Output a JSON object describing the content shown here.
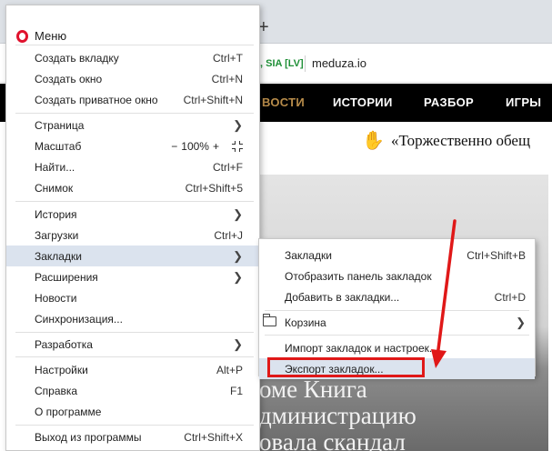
{
  "browser": {
    "new_tab_glyph": "+",
    "cert_label": ", SIA [LV]",
    "url": "meduza.io",
    "nav": [
      "ВОСТИ",
      "ИСТОРИИ",
      "РАЗБОР",
      "ИГРЫ"
    ],
    "headline": "«Торжественно обещ",
    "hero_lines": [
      "оме Книга",
      "дминистрацию",
      "овала скандал"
    ]
  },
  "menu": {
    "title": "Меню",
    "new_tab": {
      "label": "Создать вкладку",
      "shortcut": "Ctrl+T"
    },
    "new_window": {
      "label": "Создать окно",
      "shortcut": "Ctrl+N"
    },
    "new_private": {
      "label": "Создать приватное окно",
      "shortcut": "Ctrl+Shift+N"
    },
    "page": {
      "label": "Страница"
    },
    "zoom": {
      "label": "Масштаб",
      "minus": "−",
      "value": "100%",
      "plus": "+"
    },
    "find": {
      "label": "Найти...",
      "shortcut": "Ctrl+F"
    },
    "snapshot": {
      "label": "Снимок",
      "shortcut": "Ctrl+Shift+5"
    },
    "history": {
      "label": "История"
    },
    "downloads": {
      "label": "Загрузки",
      "shortcut": "Ctrl+J"
    },
    "bookmarks": {
      "label": "Закладки"
    },
    "extensions": {
      "label": "Расширения"
    },
    "news": {
      "label": "Новости"
    },
    "sync": {
      "label": "Синхронизация..."
    },
    "developer": {
      "label": "Разработка"
    },
    "settings": {
      "label": "Настройки",
      "shortcut": "Alt+P"
    },
    "help": {
      "label": "Справка",
      "shortcut": "F1"
    },
    "about": {
      "label": "О программе"
    },
    "exit": {
      "label": "Выход из программы",
      "shortcut": "Ctrl+Shift+X"
    }
  },
  "submenu": {
    "bookmarks": {
      "label": "Закладки",
      "shortcut": "Ctrl+Shift+B"
    },
    "show_bar": {
      "label": "Отобразить панель закладок"
    },
    "add": {
      "label": "Добавить в закладки...",
      "shortcut": "Ctrl+D"
    },
    "trash": {
      "label": "Корзина"
    },
    "import": {
      "label": "Импорт закладок и настроек..."
    },
    "export": {
      "label": "Экспорт закладок..."
    }
  },
  "colors": {
    "opera_red": "#e0122d",
    "annotation_red": "#e01818",
    "hover_bg": "#dbe3ee",
    "nav_active": "#b88c4a"
  }
}
